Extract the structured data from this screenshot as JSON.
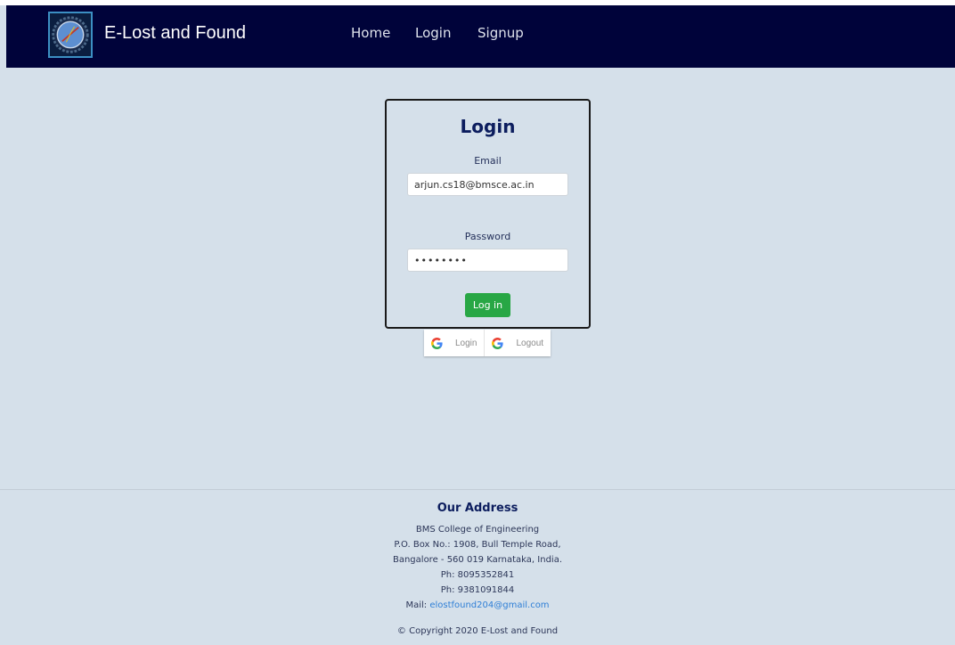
{
  "navbar": {
    "brand": "E-Lost and Found",
    "logo_icon": "college-emblem-icon",
    "background": "#00033a",
    "links": [
      "Home",
      "Login",
      "Signup"
    ]
  },
  "login_card": {
    "title": "Login",
    "email_label": "Email",
    "email_value": "arjun.cs18@bmsce.ac.in",
    "password_label": "Password",
    "password_value": "••••••••",
    "submit_label": "Log in",
    "submit_color": "#28a745"
  },
  "google_buttons": {
    "icon": "google-icon",
    "login_label": "Login",
    "logout_label": "Logout"
  },
  "footer": {
    "title": "Our Address",
    "college": "BMS College of Engineering",
    "address_line1": "P.O. Box No.: 1908, Bull Temple Road,",
    "address_line2": "Bangalore - 560 019 Karnataka, India.",
    "phone1": "Ph: 8095352841",
    "phone2": "Ph: 9381091844",
    "mail_prefix": "Mail: ",
    "mail": "elostfound204@gmail.com",
    "copyright": "© Copyright 2020 E-Lost and Found"
  }
}
